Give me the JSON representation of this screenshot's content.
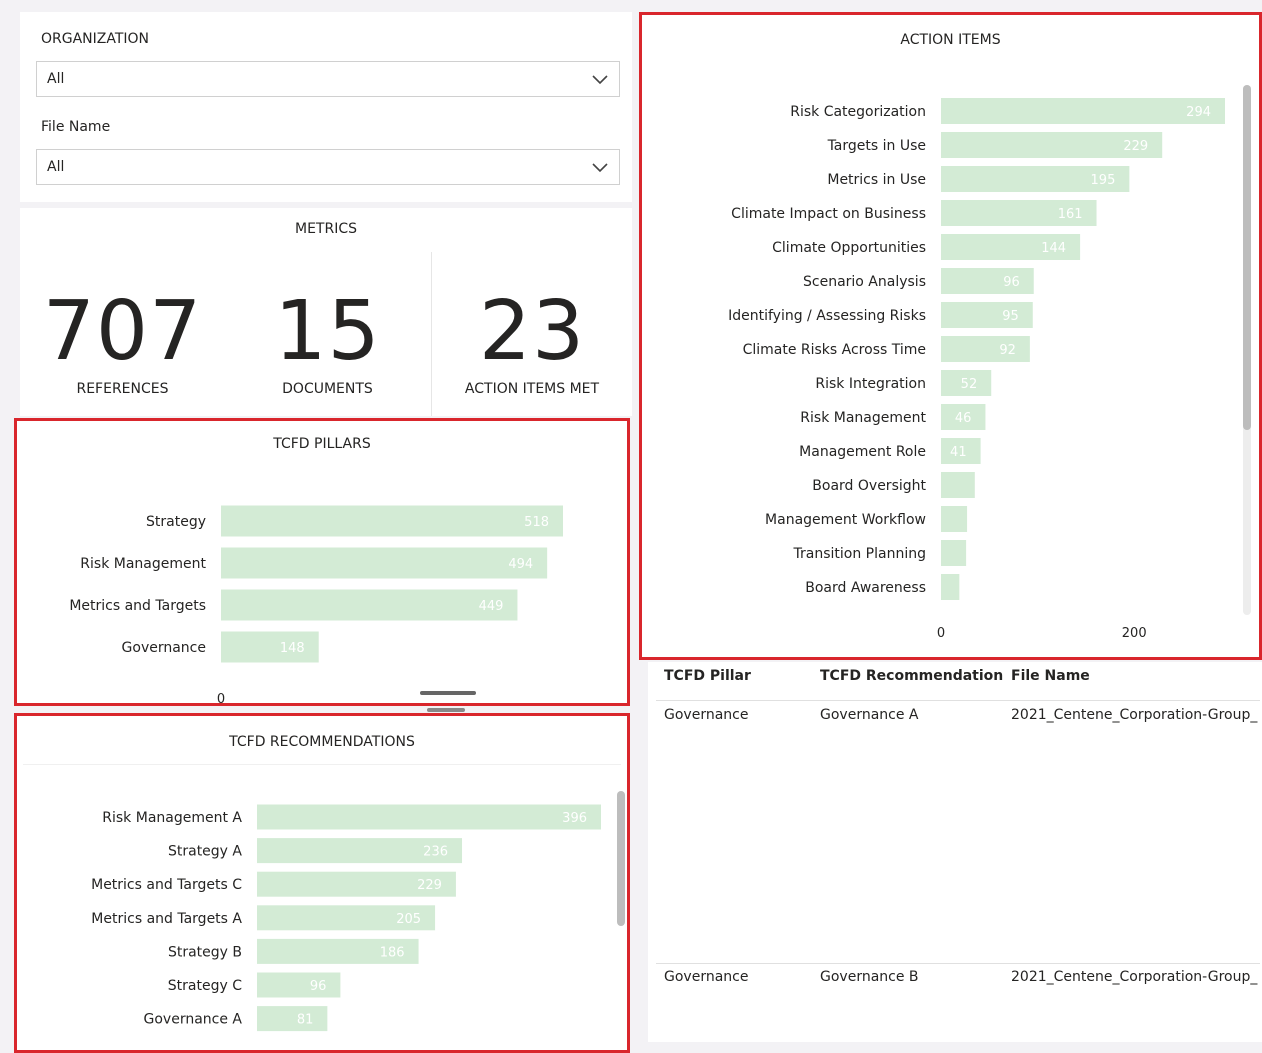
{
  "filters": {
    "organization_label": "ORGANIZATION",
    "organization_value": "All",
    "file_label": "File Name",
    "file_value": "All"
  },
  "metrics": {
    "title": "METRICS",
    "references_value": "707",
    "references_label": "REFERENCES",
    "documents_value": "15",
    "documents_label": "DOCUMENTS",
    "action_items_value": "23",
    "action_items_label": "ACTION ITEMS MET"
  },
  "colors": {
    "bar": "#d3ebd5",
    "bar_label": "#ffffff",
    "highlight_border": "#d9262c"
  },
  "chart_data": [
    {
      "id": "pillars",
      "type": "bar",
      "orientation": "horizontal",
      "title": "TCFD PILLARS",
      "categories": [
        "Strategy",
        "Risk Management",
        "Metrics and Targets",
        "Governance"
      ],
      "values": [
        518,
        494,
        449,
        148
      ],
      "xlim": [
        0,
        518
      ],
      "x_ticks": [
        "0"
      ]
    },
    {
      "id": "recommendations",
      "type": "bar",
      "orientation": "horizontal",
      "title": "TCFD RECOMMENDATIONS",
      "categories": [
        "Risk Management A",
        "Strategy A",
        "Metrics and Targets C",
        "Metrics and Targets A",
        "Strategy B",
        "Strategy C",
        "Governance A"
      ],
      "values": [
        396,
        236,
        229,
        205,
        186,
        96,
        81
      ],
      "xlim": [
        0,
        396
      ]
    },
    {
      "id": "action_items",
      "type": "bar",
      "orientation": "horizontal",
      "title": "ACTION ITEMS",
      "categories": [
        "Risk Categorization",
        "Targets in Use",
        "Metrics in Use",
        "Climate Impact on Business",
        "Climate Opportunities",
        "Scenario Analysis",
        "Identifying / Assessing Risks",
        "Climate Risks Across Time",
        "Risk Integration",
        "Risk Management",
        "Management Role",
        "Board Oversight",
        "Management Workflow",
        "Transition Planning",
        "Board Awareness"
      ],
      "values": [
        294,
        229,
        195,
        161,
        144,
        96,
        95,
        92,
        52,
        46,
        41,
        35,
        27,
        26,
        19
      ],
      "value_labels_shown": [
        true,
        true,
        true,
        true,
        true,
        true,
        true,
        true,
        true,
        true,
        true,
        false,
        false,
        false,
        false
      ],
      "xlim": [
        0,
        294
      ],
      "x_ticks": [
        "0",
        "200"
      ],
      "x_tick_values": [
        0,
        200
      ]
    }
  ],
  "table": {
    "headers": [
      "TCFD Pillar",
      "TCFD Recommendation",
      "File Name"
    ],
    "rows": [
      [
        "Governance",
        "Governance A",
        "2021_Centene_Corporation-Group_"
      ],
      [
        "Governance",
        "Governance B",
        "2021_Centene_Corporation-Group_"
      ]
    ]
  }
}
